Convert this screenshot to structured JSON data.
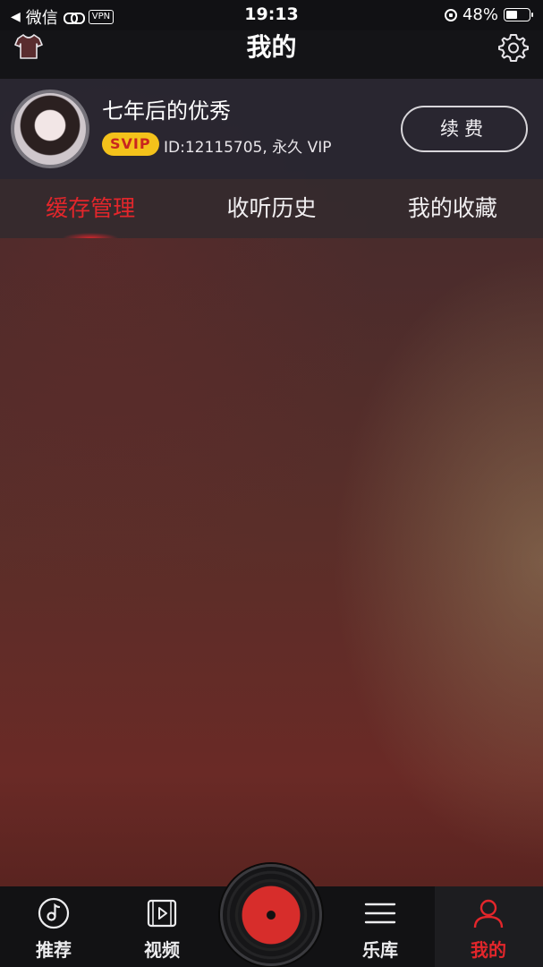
{
  "status_bar": {
    "back_app": "微信",
    "vpn": "VPN",
    "time": "19:13",
    "battery": "48%",
    "battery_level": 0.48
  },
  "nav": {
    "title": "我的",
    "left_icon": "tshirt-skin-icon",
    "right_icon": "gear-icon"
  },
  "profile": {
    "username": "七年后的优秀",
    "vip_badge": "SVIP",
    "user_id": "ID:12115705, 永久 VIP",
    "renew_label": "续费"
  },
  "tabs": [
    {
      "label": "缓存管理",
      "active": true
    },
    {
      "label": "收听历史",
      "active": false
    },
    {
      "label": "我的收藏",
      "active": false
    }
  ],
  "tab_bar": [
    {
      "label": "推荐",
      "icon": "music-note-circle-icon",
      "active": false
    },
    {
      "label": "视频",
      "icon": "video-play-icon",
      "active": false
    },
    {
      "label": "乐库",
      "icon": "menu-lines-icon",
      "active": false
    },
    {
      "label": "我的",
      "icon": "person-icon",
      "active": true
    }
  ],
  "colors": {
    "accent": "#e3262b",
    "vip_gold": "#f4c21b"
  }
}
